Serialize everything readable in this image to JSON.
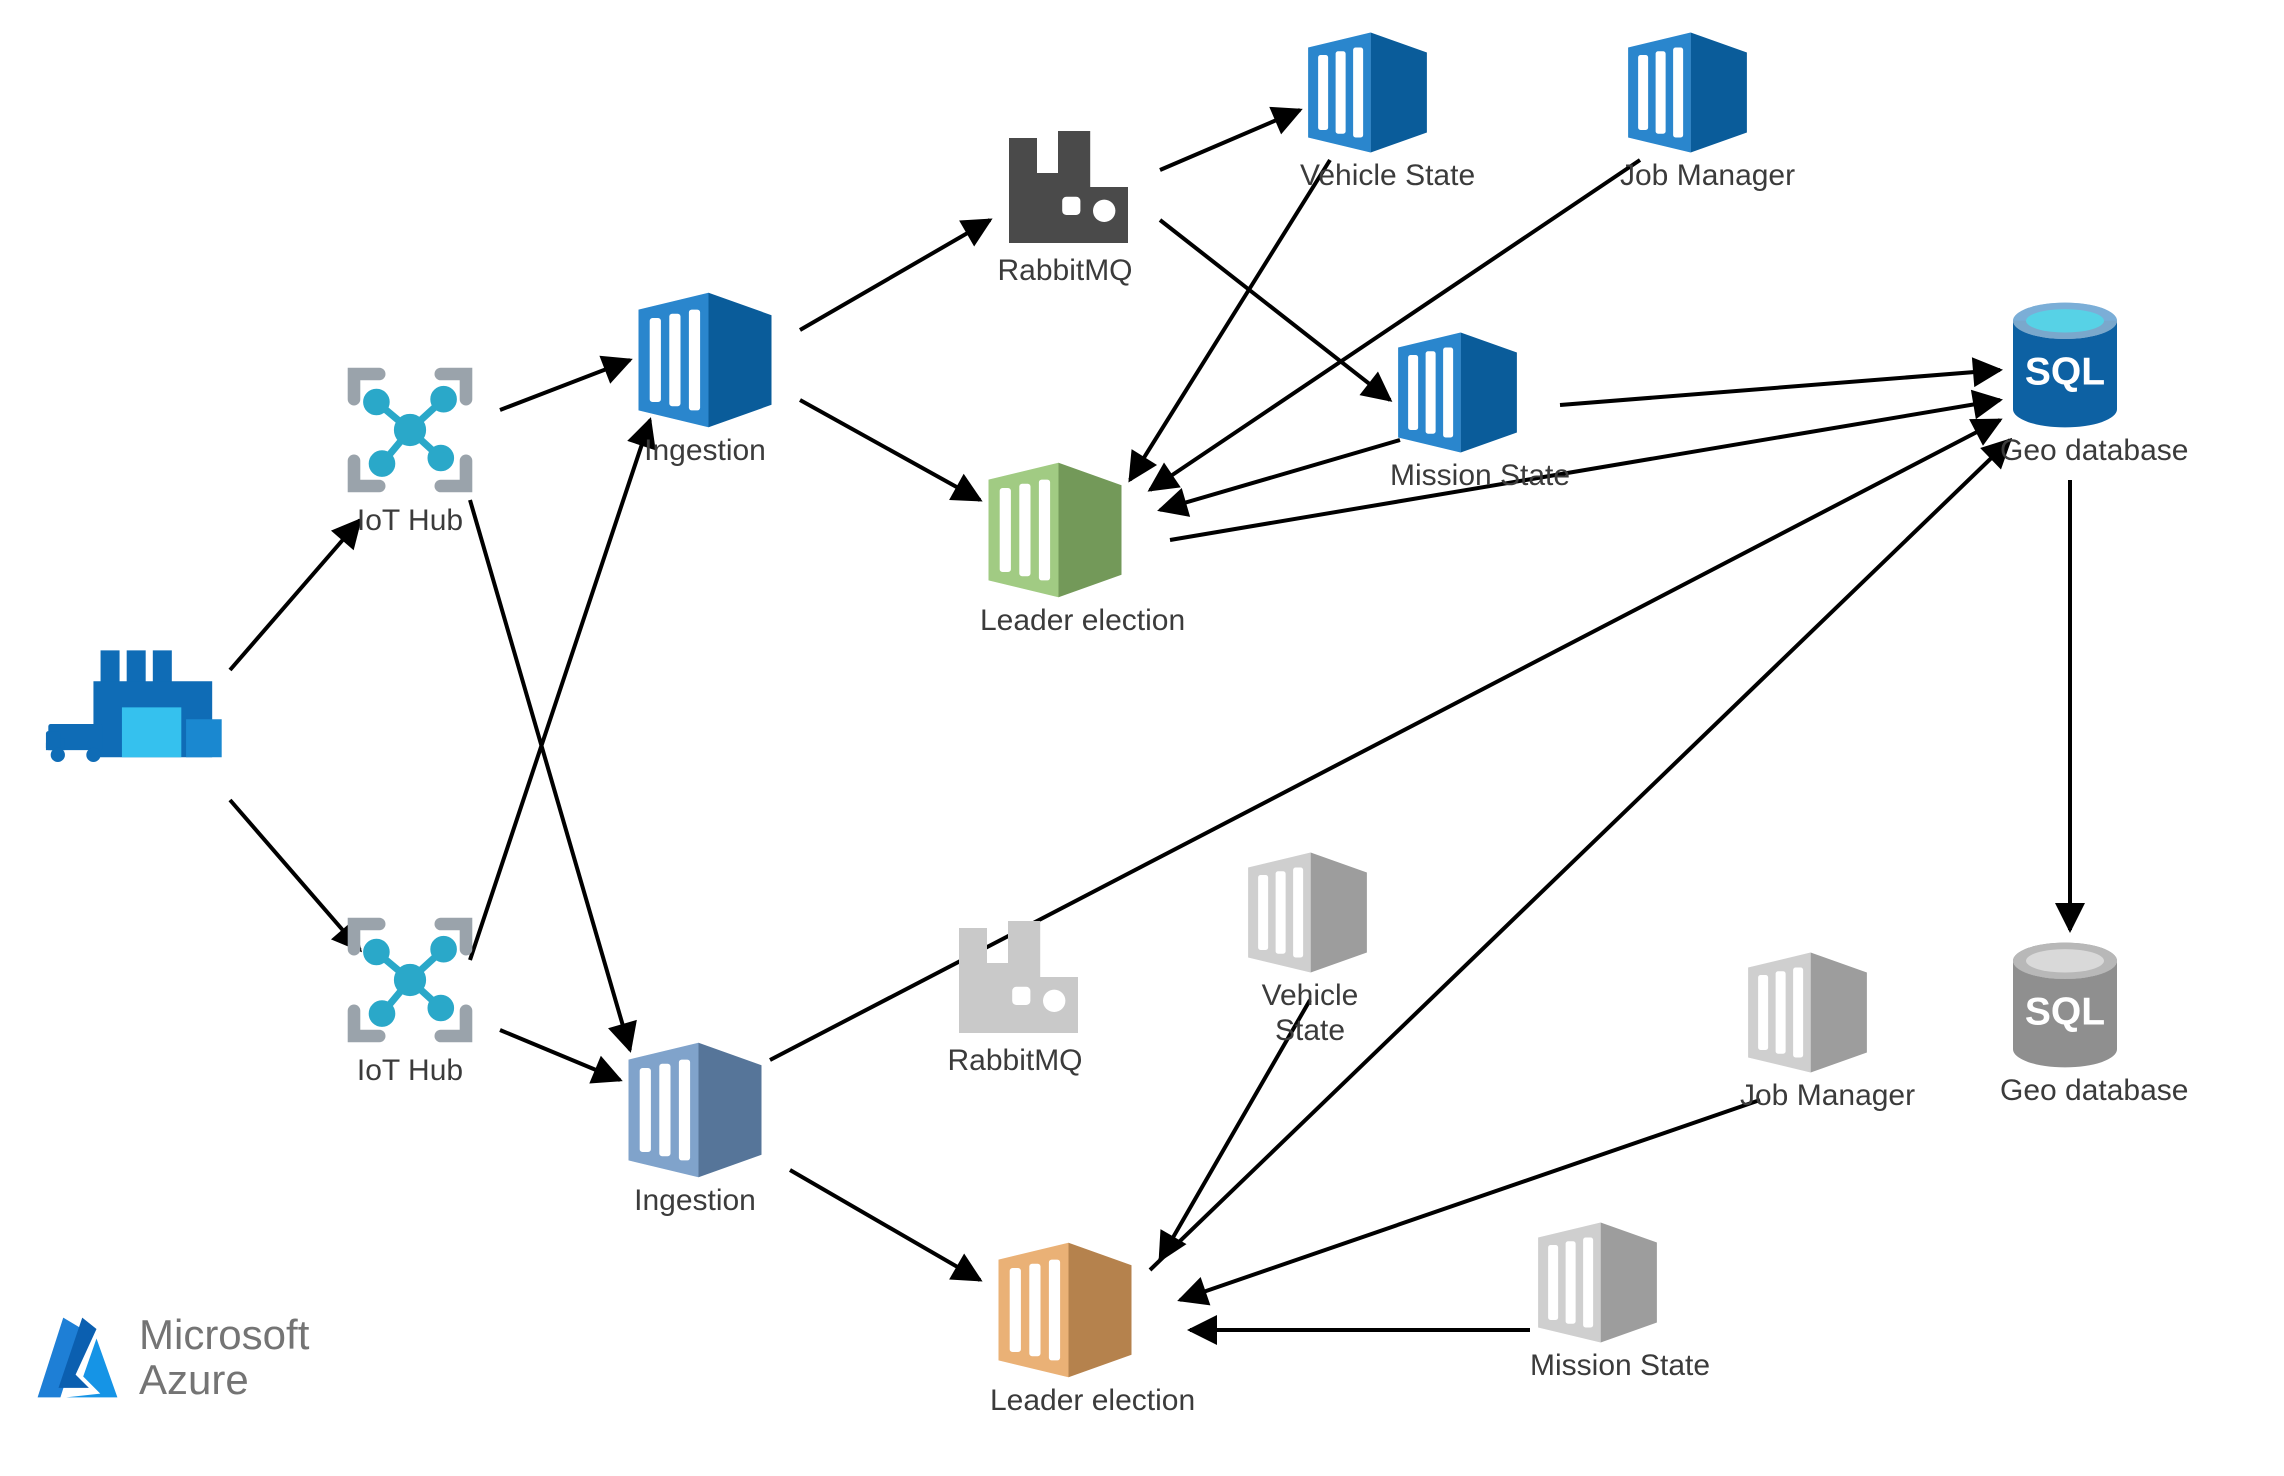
{
  "brand": {
    "line1": "Microsoft",
    "line2": "Azure"
  },
  "nodes": {
    "iothub1": "IoT Hub",
    "iothub2": "IoT Hub",
    "ingestion1": "Ingestion",
    "ingestion2": "Ingestion",
    "rabbitmq1": "RabbitMQ",
    "rabbitmq2": "RabbitMQ",
    "vehiclestate1": "Vehicle State",
    "vehiclestate2": "Vehicle\nState",
    "jobmanager1": "Job Manager",
    "jobmanager2": "Job Manager",
    "missionstate1": "Mission State",
    "missionstate2": "Mission State",
    "leader1": "Leader election",
    "leader2": "Leader election",
    "geodb1": "Geo database",
    "geodb2": "Geo database",
    "sql": "SQL"
  }
}
